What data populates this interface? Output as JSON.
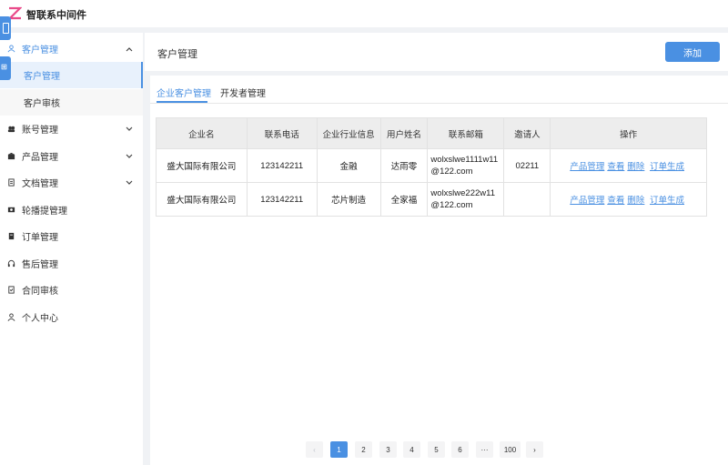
{
  "app": {
    "title": "智联系中间件"
  },
  "sidebar": {
    "items": [
      {
        "label": "客户管理",
        "icon": "user-icon"
      },
      {
        "label": "客户管理"
      },
      {
        "label": "客户审核"
      },
      {
        "label": "账号管理",
        "icon": "team-icon"
      },
      {
        "label": "产品管理",
        "icon": "package-icon"
      },
      {
        "label": "文档管理",
        "icon": "document-icon"
      },
      {
        "label": "轮播提管理",
        "icon": "picture-icon"
      },
      {
        "label": "订单管理",
        "icon": "order-icon"
      },
      {
        "label": "售后管理",
        "icon": "headset-icon"
      },
      {
        "label": "合同审核",
        "icon": "contract-icon"
      },
      {
        "label": "个人中心",
        "icon": "person-icon"
      }
    ]
  },
  "header": {
    "page_title": "客户管理",
    "add_label": "添加"
  },
  "tabs": [
    {
      "label": "企业客户管理"
    },
    {
      "label": "开发者管理"
    }
  ],
  "table": {
    "columns": [
      "企业名",
      "联系电话",
      "企业行业信息",
      "用户姓名",
      "联系邮箱",
      "邀请人",
      "操作"
    ],
    "rows": [
      {
        "company": "盛大国际有限公司",
        "phone": "123142211",
        "industry": "金融",
        "user": "达雨零",
        "email_line1": "wolxslwe1111w11",
        "email_line2": "@122.com",
        "inviter": "02211"
      },
      {
        "company": "盛大国际有限公司",
        "phone": "123142211",
        "industry": "芯片制造",
        "user": "全家福",
        "email_line1": "wolxslwe222w11",
        "email_line2": "@122.com",
        "inviter": ""
      }
    ],
    "actions": {
      "product": "产品管理",
      "view": "查看",
      "delete": "删除",
      "order": "订单生成"
    }
  },
  "pagination": {
    "prev": "‹",
    "pages": [
      "1",
      "2",
      "3",
      "4",
      "5",
      "6",
      "···",
      "100"
    ],
    "next": "›",
    "current": "1"
  },
  "colors": {
    "accent": "#4a90e2",
    "brand_logo": "#e94b8a"
  }
}
